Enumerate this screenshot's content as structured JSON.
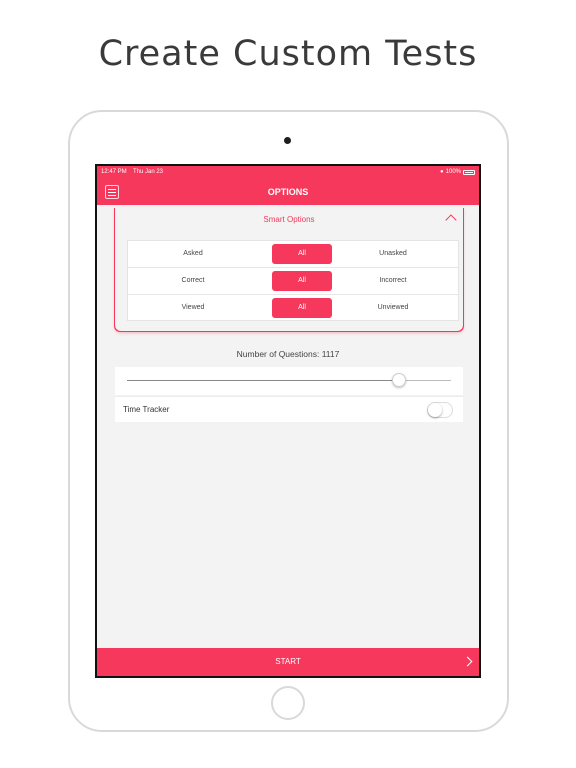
{
  "headline": "Create Custom Tests",
  "status_bar": {
    "time": "12:47 PM",
    "date": "Thu Jan 23",
    "battery": "100%"
  },
  "nav": {
    "title": "OPTIONS",
    "menu_icon": "menu-icon"
  },
  "smart_options": {
    "title": "Smart Options",
    "expanded": true,
    "rows": [
      {
        "left": "Asked",
        "middle": "All",
        "right": "Unasked",
        "selected": "middle"
      },
      {
        "left": "Correct",
        "middle": "All",
        "right": "Incorrect",
        "selected": "middle"
      },
      {
        "left": "Viewed",
        "middle": "All",
        "right": "Unviewed",
        "selected": "middle"
      }
    ]
  },
  "questions": {
    "label": "Number of Questions: 1117",
    "slider_fraction": 0.84
  },
  "time_tracker": {
    "label": "Time Tracker",
    "enabled": false
  },
  "start": {
    "label": "START"
  },
  "colors": {
    "accent": "#f5385b",
    "background": "#f3f3f3"
  }
}
